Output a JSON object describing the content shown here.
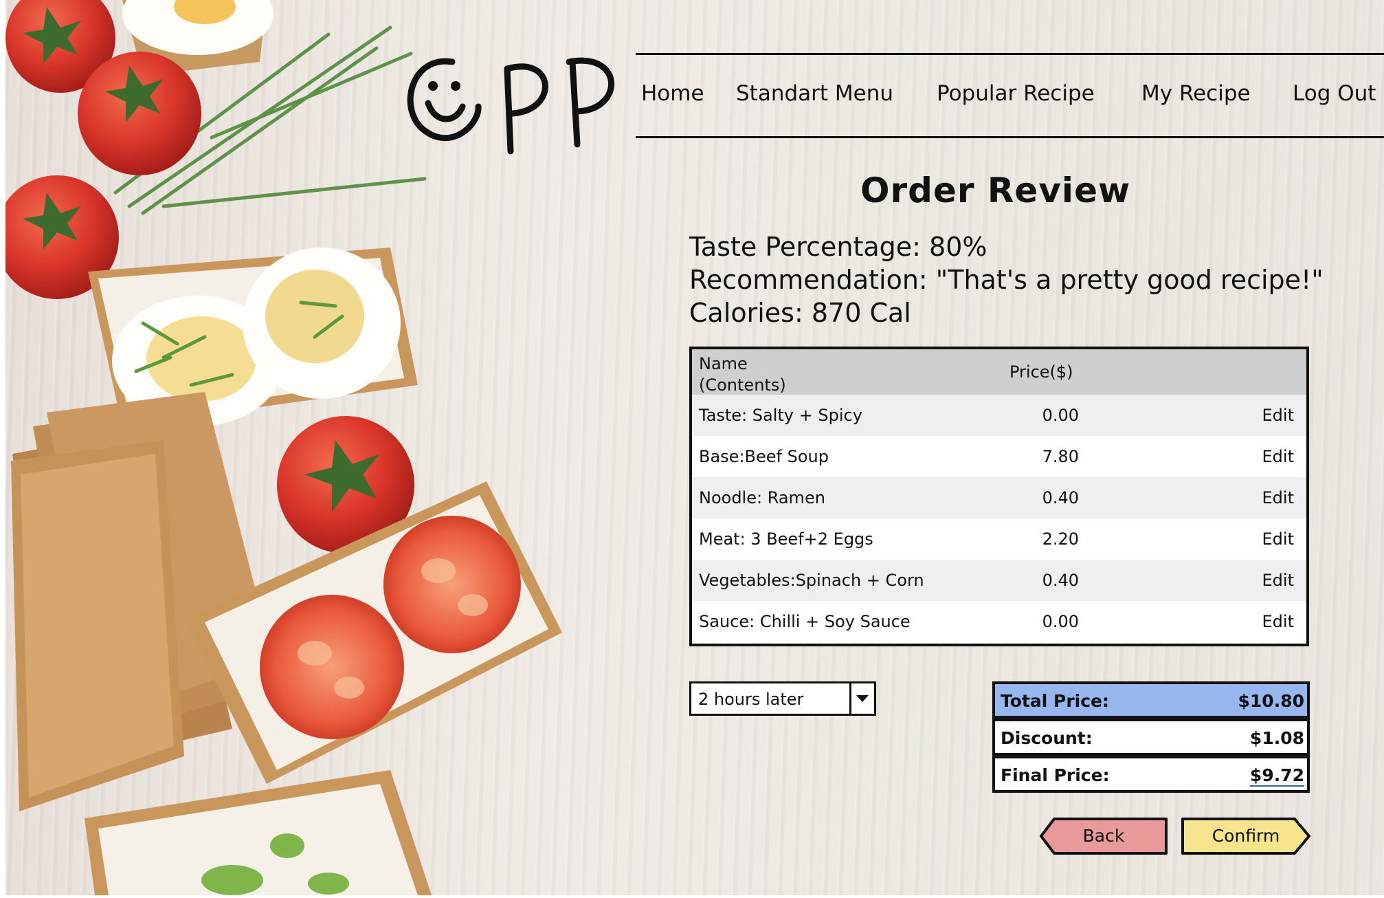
{
  "nav": {
    "items": [
      "Home",
      "Standart Menu",
      "Popular Recipe",
      "My Recipe",
      "Log Out"
    ]
  },
  "page": {
    "title": "Order Review",
    "taste_percentage": "Taste Percentage: 80%",
    "recommendation": "Recommendation: \"That's a pretty good recipe!\"",
    "calories": "Calories:  870 Cal"
  },
  "table": {
    "headers": {
      "name_line1": "Name",
      "name_line2": "(Contents)",
      "price": "Price($)"
    },
    "rows": [
      {
        "name": "Taste: Salty + Spicy",
        "price": "0.00",
        "action": "Edit"
      },
      {
        "name": "Base:Beef Soup",
        "price": "7.80",
        "action": "Edit"
      },
      {
        "name": "Noodle: Ramen",
        "price": "0.40",
        "action": "Edit"
      },
      {
        "name": "Meat: 3 Beef+2 Eggs",
        "price": "2.20",
        "action": "Edit"
      },
      {
        "name": "Vegetables:Spinach + Corn",
        "price": "0.40",
        "action": "Edit"
      },
      {
        "name": "Sauce: Chilli + Soy Sauce",
        "price": "0.00",
        "action": "Edit"
      }
    ]
  },
  "pickup": {
    "selected": "2 hours later"
  },
  "summary": {
    "total_label": "Total Price:",
    "total_value": "$10.80",
    "discount_label": "Discount:",
    "discount_value": "$1.08",
    "final_label": "Final Price:",
    "final_value": "$9.72"
  },
  "buttons": {
    "back": "Back",
    "confirm": "Confirm"
  },
  "colors": {
    "total_highlight": "#97b7ee",
    "back_button": "#e89a9a",
    "confirm_button": "#f7e58e"
  }
}
